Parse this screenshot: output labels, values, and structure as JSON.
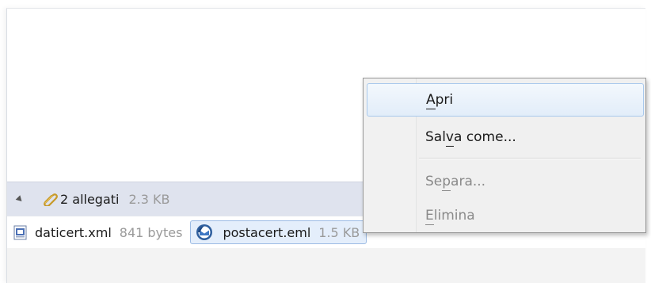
{
  "attachments_header": {
    "count_label": "2 allegati",
    "total_size": "2.3 KB"
  },
  "attachments": [
    {
      "name": "daticert.xml",
      "size": "841 bytes",
      "icon": "xml-file-icon",
      "selected": false
    },
    {
      "name": "postacert.eml",
      "size": "1.5 KB",
      "icon": "thunderbird-eml-icon",
      "selected": true
    }
  ],
  "context_menu": {
    "items": [
      {
        "label": "Apri",
        "accelerator": "A",
        "enabled": true,
        "highlighted": true
      },
      {
        "label": "Salva come...",
        "accelerator": "v",
        "enabled": true,
        "highlighted": false
      },
      {
        "label": "Separa...",
        "accelerator": "p",
        "enabled": false,
        "highlighted": false
      },
      {
        "label": "Elimina",
        "accelerator": "E",
        "enabled": false,
        "highlighted": false
      }
    ]
  },
  "colors": {
    "header_bg": "#dfe3ee",
    "selection_bg": "#e4eefb",
    "selection_border": "#9cbbe4",
    "disabled_text": "#8a8a8a"
  }
}
